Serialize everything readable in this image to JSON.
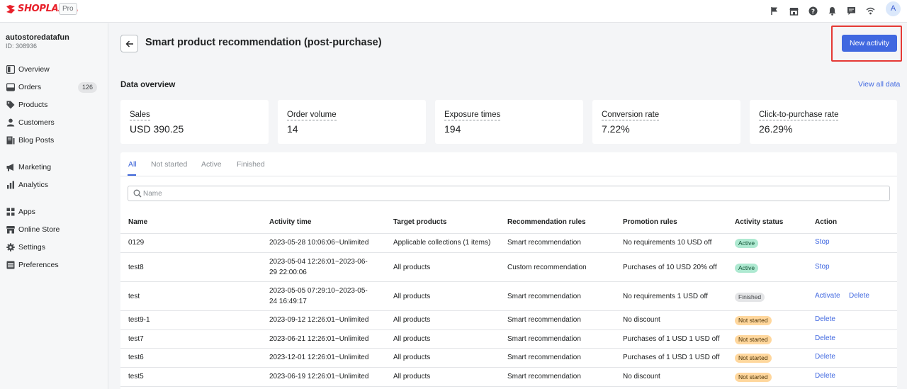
{
  "app": {
    "brand": "SHOPLAZZA",
    "plan_badge": "Pro",
    "avatar_initial": "A"
  },
  "store": {
    "name": "autostoredatafun",
    "id": "ID: 308936"
  },
  "sidebar": {
    "items": [
      {
        "label": "Overview",
        "icon": "overview-icon"
      },
      {
        "label": "Orders",
        "icon": "orders-icon",
        "badge": "126"
      },
      {
        "label": "Products",
        "icon": "tag-icon"
      },
      {
        "label": "Customers",
        "icon": "person-icon"
      },
      {
        "label": "Blog Posts",
        "icon": "blog-icon"
      },
      {
        "label": "Marketing",
        "icon": "megaphone-icon"
      },
      {
        "label": "Analytics",
        "icon": "bar-chart-icon"
      },
      {
        "label": "Apps",
        "icon": "apps-icon"
      },
      {
        "label": "Online Store",
        "icon": "store-icon"
      },
      {
        "label": "Settings",
        "icon": "gear-icon"
      },
      {
        "label": "Preferences",
        "icon": "list-icon"
      }
    ]
  },
  "header": {
    "title": "Smart product recommendation (post-purchase)",
    "new_activity_label": "New activity"
  },
  "overview": {
    "title": "Data overview",
    "view_all_label": "View all data",
    "cards": [
      {
        "label": "Sales",
        "value": "USD 390.25"
      },
      {
        "label": "Order volume",
        "value": "14"
      },
      {
        "label": "Exposure times",
        "value": "194"
      },
      {
        "label": "Conversion rate",
        "value": "7.22%"
      },
      {
        "label": "Click-to-purchase rate",
        "value": "26.29%"
      }
    ]
  },
  "tabs": [
    "All",
    "Not started",
    "Active",
    "Finished"
  ],
  "search": {
    "placeholder": "Name"
  },
  "table": {
    "columns": [
      "Name",
      "Activity time",
      "Target products",
      "Recommendation rules",
      "Promotion rules",
      "Activity status",
      "Action"
    ],
    "rows": [
      {
        "name": "0129",
        "time1": "2023-05-28 10:06:06~Unlimited",
        "time2": "",
        "target": "Applicable collections (1 items)",
        "rec": "Smart recommendation",
        "promo": "No requirements 10 USD off",
        "status": "Active",
        "actions": [
          "Stop"
        ]
      },
      {
        "name": "test8",
        "time1": "2023-05-04 12:26:01~2023-06-",
        "time2": "29 22:00:06",
        "target": "All products",
        "rec": "Custom recommendation",
        "promo": "Purchases of 10 USD 20% off",
        "status": "Active",
        "actions": [
          "Stop"
        ]
      },
      {
        "name": "test",
        "time1": "2023-05-05 07:29:10~2023-05-",
        "time2": "24 16:49:17",
        "target": "All products",
        "rec": "Smart recommendation",
        "promo": "No requirements 1 USD off",
        "status": "Finished",
        "actions": [
          "Activate",
          "Delete"
        ]
      },
      {
        "name": "test9-1",
        "time1": "2023-09-12 12:26:01~Unlimited",
        "time2": "",
        "target": "All products",
        "rec": "Smart recommendation",
        "promo": "No discount",
        "status": "Not started",
        "actions": [
          "Delete"
        ]
      },
      {
        "name": "test7",
        "time1": "2023-06-21 12:26:01~Unlimited",
        "time2": "",
        "target": "All products",
        "rec": "Smart recommendation",
        "promo": "Purchases of 1 USD 1 USD off",
        "status": "Not started",
        "actions": [
          "Delete"
        ]
      },
      {
        "name": "test6",
        "time1": "2023-12-01 12:26:01~Unlimited",
        "time2": "",
        "target": "All products",
        "rec": "Smart recommendation",
        "promo": "Purchases of 1 USD 1 USD off",
        "status": "Not started",
        "actions": [
          "Delete"
        ]
      },
      {
        "name": "test5",
        "time1": "2023-06-19 12:26:01~Unlimited",
        "time2": "",
        "target": "All products",
        "rec": "Smart recommendation",
        "promo": "No discount",
        "status": "Not started",
        "actions": [
          "Delete"
        ]
      }
    ]
  },
  "colors": {
    "accent": "#4068e0",
    "brand": "#e8202a",
    "highlight": "#e53935"
  }
}
